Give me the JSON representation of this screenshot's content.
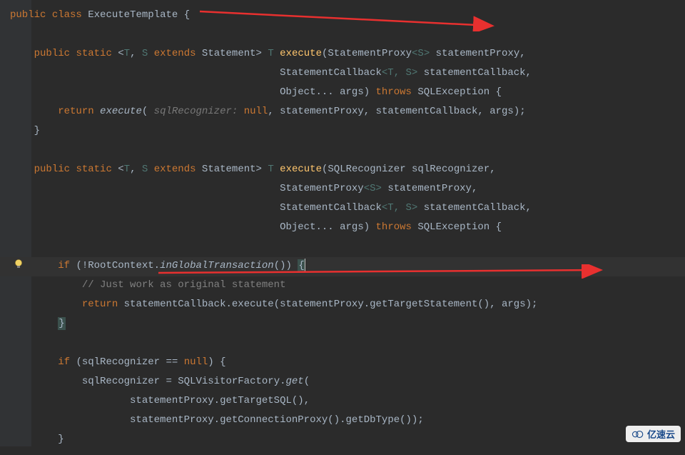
{
  "editor": {
    "class_decl": {
      "public": "public",
      "class": "class",
      "name": "ExecuteTemplate",
      "brace": "{"
    },
    "method1": {
      "sig": {
        "public": "public",
        "static": "static",
        "open": "<",
        "T": "T",
        "comma": ", ",
        "S": "S",
        "extends": "extends",
        "Statement": "Statement",
        "close": ">",
        "ret": "T",
        "name": "execute",
        "lparen": "(",
        "p1t": "StatementProxy",
        "p1g": "<S>",
        "p1n": "statementProxy",
        "c": ","
      },
      "p2": {
        "t": "StatementCallback",
        "g": "<T, S>",
        "n": "statementCallback",
        "c": ","
      },
      "p3": {
        "t": "Object",
        "dots": "...",
        "n": "args",
        "rp": ")",
        "throws": "throws",
        "exc": "SQLException",
        "brace": "{"
      },
      "body": {
        "return": "return",
        "call": "execute",
        "lparen": "(",
        "label": "sqlRecognizer:",
        "null": "null",
        "c1": ",",
        "a1": "statementProxy",
        "c2": ",",
        "a2": "statementCallback",
        "c3": ",",
        "a3": "args",
        "rp": ")",
        "semi": ";"
      },
      "close": "}"
    },
    "method2": {
      "sig": {
        "public": "public",
        "static": "static",
        "open": "<",
        "T": "T",
        "comma": ", ",
        "S": "S",
        "extends": "extends",
        "Statement": "Statement",
        "close": ">",
        "ret": "T",
        "name": "execute",
        "lparen": "(",
        "p1t": "SQLRecognizer",
        "p1n": "sqlRecognizer",
        "c": ","
      },
      "p2": {
        "t": "StatementProxy",
        "g": "<S>",
        "n": "statementProxy",
        "c": ","
      },
      "p3": {
        "t": "StatementCallback",
        "g": "<T, S>",
        "n": "statementCallback",
        "c": ","
      },
      "p4": {
        "t": "Object",
        "dots": "...",
        "n": "args",
        "rp": ")",
        "throws": "throws",
        "exc": "SQLException",
        "brace": "{"
      },
      "if1": {
        "if": "if",
        "lp": "(",
        "not": "!",
        "cls": "RootContext",
        "dot": ".",
        "m": "inGlobalTransaction",
        "call": "()",
        "rp": ")",
        "brace": "{"
      },
      "comment": "// Just work as original statement",
      "ret": {
        "return": "return",
        "o": "statementCallback",
        "dot": ".",
        "m": "execute",
        "lp": "(",
        "a1": "statementProxy",
        "d1": ".",
        "m1": "getTargetStatement",
        "c1": "()",
        "c": ",",
        "a2": "args",
        "rp": ")",
        "semi": ";"
      },
      "close1": "}",
      "if2": {
        "if": "if",
        "lp": "(",
        "v": "sqlRecognizer",
        "op": "==",
        "null": "null",
        "rp": ")",
        "brace": "{"
      },
      "assign": {
        "v": "sqlRecognizer",
        "eq": "=",
        "cls": "SQLVisitorFactory",
        "dot": ".",
        "m": "get",
        "lp": "("
      },
      "arg1": {
        "o": "statementProxy",
        "dot": ".",
        "m": "getTargetSQL",
        "call": "()",
        "c": ","
      },
      "arg2": {
        "o": "statementProxy",
        "dot": ".",
        "m1": "getConnectionProxy",
        "c1": "()",
        "d2": ".",
        "m2": "getDbType",
        "c2": "()",
        "rp": ")",
        "semi": ";"
      },
      "close2": "}"
    }
  },
  "watermark": {
    "text": "亿速云"
  }
}
